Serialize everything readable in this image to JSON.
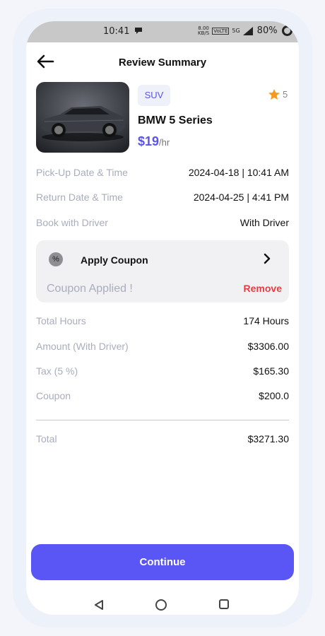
{
  "statusbar": {
    "time": "10:41",
    "speed_value": "8.00",
    "speed_unit": "KB/S",
    "network": "VoLTE",
    "signal": "5G",
    "battery": "80%"
  },
  "header": {
    "title": "Review Summary"
  },
  "car": {
    "tag": "SUV",
    "rating": "5",
    "name": "BMW 5 Series",
    "price": "$19",
    "price_unit": "/hr"
  },
  "details": [
    {
      "label": "Pick-Up Date & Time",
      "value": "2024-04-18 | 10:41 AM"
    },
    {
      "label": "Return Date & Time",
      "value": "2024-04-25 | 4:41 PM"
    },
    {
      "label": "Book with Driver",
      "value": "With Driver"
    }
  ],
  "coupon": {
    "title": "Apply Coupon",
    "status": "Coupon Applied !",
    "remove_label": "Remove"
  },
  "summary": [
    {
      "label": "Total Hours",
      "value": "174 Hours"
    },
    {
      "label": "Amount (With Driver)",
      "value": "$3306.00"
    },
    {
      "label": "Tax (5 %)",
      "value": "$165.30"
    },
    {
      "label": "Coupon",
      "value": "$200.0"
    }
  ],
  "total": {
    "label": "Total",
    "value": "$3271.30"
  },
  "actions": {
    "continue_label": "Continue"
  },
  "colors": {
    "accent": "#5a55f5",
    "remove": "#e04040",
    "star": "#f59a1b",
    "muted": "#a9adbd"
  },
  "icons": {
    "back": "arrow-left-icon",
    "star": "star-icon",
    "coupon": "percent-icon",
    "chevron": "chevron-right-icon"
  }
}
